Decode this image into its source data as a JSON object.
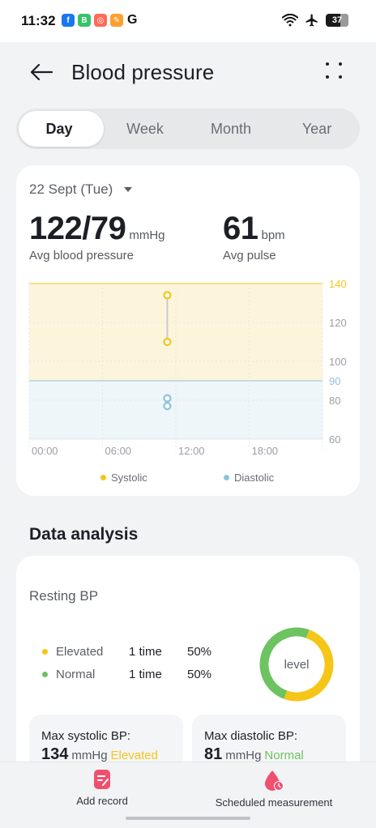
{
  "status_bar": {
    "time": "11:32",
    "app_icons": [
      {
        "name": "facebook-icon",
        "glyph": "f",
        "color": "#1877f2"
      },
      {
        "name": "messenger-app-icon",
        "glyph": "B",
        "color": "#35c46a"
      },
      {
        "name": "app-red-icon",
        "glyph": "◎",
        "color": "#ff6b57"
      },
      {
        "name": "app-orange-icon",
        "glyph": "✎",
        "color": "#ff9f2e"
      }
    ],
    "g_letter": "G",
    "battery_level": "37",
    "battery_fraction": 0.37
  },
  "header": {
    "title": "Blood pressure"
  },
  "tabs": [
    {
      "label": "Day",
      "active": true
    },
    {
      "label": "Week",
      "active": false
    },
    {
      "label": "Month",
      "active": false
    },
    {
      "label": "Year",
      "active": false
    }
  ],
  "summary": {
    "date": "22 Sept (Tue)",
    "bp_value": "122/79",
    "bp_unit": "mmHg",
    "bp_label": "Avg blood pressure",
    "pulse_value": "61",
    "pulse_unit": "bpm",
    "pulse_label": "Avg pulse"
  },
  "chart_data": {
    "type": "scatter",
    "x_ticks": [
      "00:00",
      "06:00",
      "12:00",
      "18:00"
    ],
    "y_ticks": [
      60,
      80,
      90,
      100,
      120,
      140
    ],
    "ylim": [
      60,
      140
    ],
    "xlim_hours": [
      0,
      24
    ],
    "systolic_band": [
      90,
      140
    ],
    "diastolic_band": [
      60,
      90
    ],
    "series": [
      {
        "name": "Systolic",
        "color": "#f5c518",
        "points": [
          {
            "x_hour": 11.3,
            "y": 134
          },
          {
            "x_hour": 11.3,
            "y": 110
          }
        ]
      },
      {
        "name": "Diastolic",
        "color": "#8ec3da",
        "points": [
          {
            "x_hour": 11.3,
            "y": 81
          },
          {
            "x_hour": 11.3,
            "y": 77
          }
        ]
      }
    ],
    "colors": {
      "systolic_band": "#fdf4dc",
      "diastolic_band": "#eef6fa",
      "tick_systolic": "#f5c518",
      "tick_diastolic": "#8ec3da",
      "tick_default": "#9a9ea4"
    }
  },
  "data_analysis": {
    "title": "Data analysis",
    "resting_title": "Resting BP",
    "levels": [
      {
        "label": "Elevated",
        "count": "1 time",
        "percent": "50%",
        "color": "#f5c518",
        "fraction": 0.5
      },
      {
        "label": "Normal",
        "count": "1 time",
        "percent": "50%",
        "color": "#6cc360",
        "fraction": 0.5
      }
    ],
    "donut_label": "level",
    "max_systolic": {
      "label": "Max systolic BP:",
      "value": "134",
      "unit": "mmHg",
      "status": "Elevated",
      "status_color": "#f5c518"
    },
    "max_diastolic": {
      "label": "Max diastolic BP:",
      "value": "81",
      "unit": "mmHg",
      "status": "Normal",
      "status_color": "#6cc360"
    }
  },
  "bottom_actions": {
    "add_record": "Add record",
    "scheduled": "Scheduled measurement"
  }
}
